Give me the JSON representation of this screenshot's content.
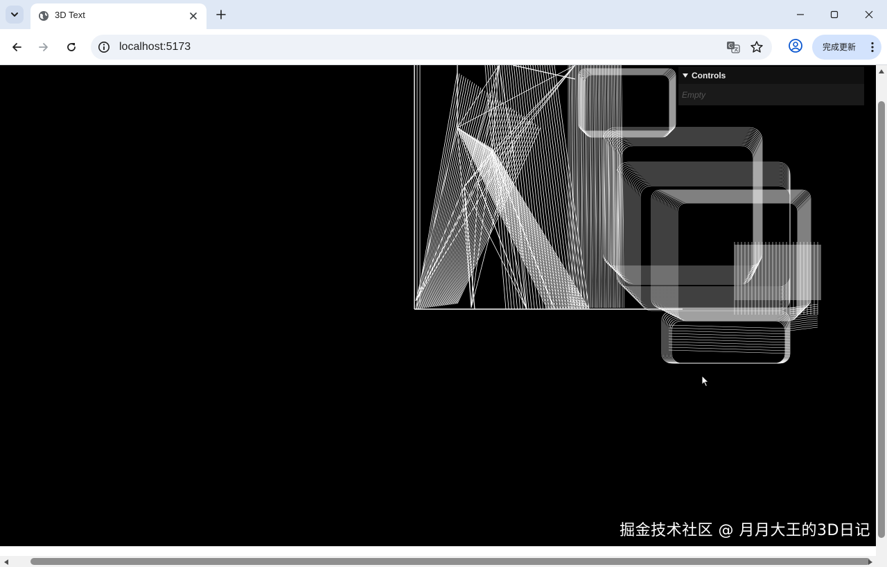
{
  "browser": {
    "tab": {
      "title": "3D Text",
      "favicon": "globe-icon"
    },
    "address": {
      "url": "localhost:5173"
    },
    "update_button": {
      "label": "完成更新"
    },
    "icons": {
      "tab_search": "chevron-down-icon",
      "new_tab": "plus-icon",
      "back": "arrow-left-icon",
      "forward": "arrow-right-icon",
      "reload": "reload-icon",
      "site_info": "info-icon",
      "translate": "translate-icon",
      "bookmark": "star-icon",
      "profile": "profile-icon",
      "menu": "more-vert-icon",
      "minimize": "minimize-icon",
      "maximize": "maximize-icon",
      "close": "close-icon"
    }
  },
  "page": {
    "background": "#000000",
    "wireframe_color": "#ffffff",
    "gui": {
      "title": "Controls",
      "empty_text": "Empty"
    },
    "watermark": "掘金技术社区 @ 月月大王的3D日记"
  }
}
